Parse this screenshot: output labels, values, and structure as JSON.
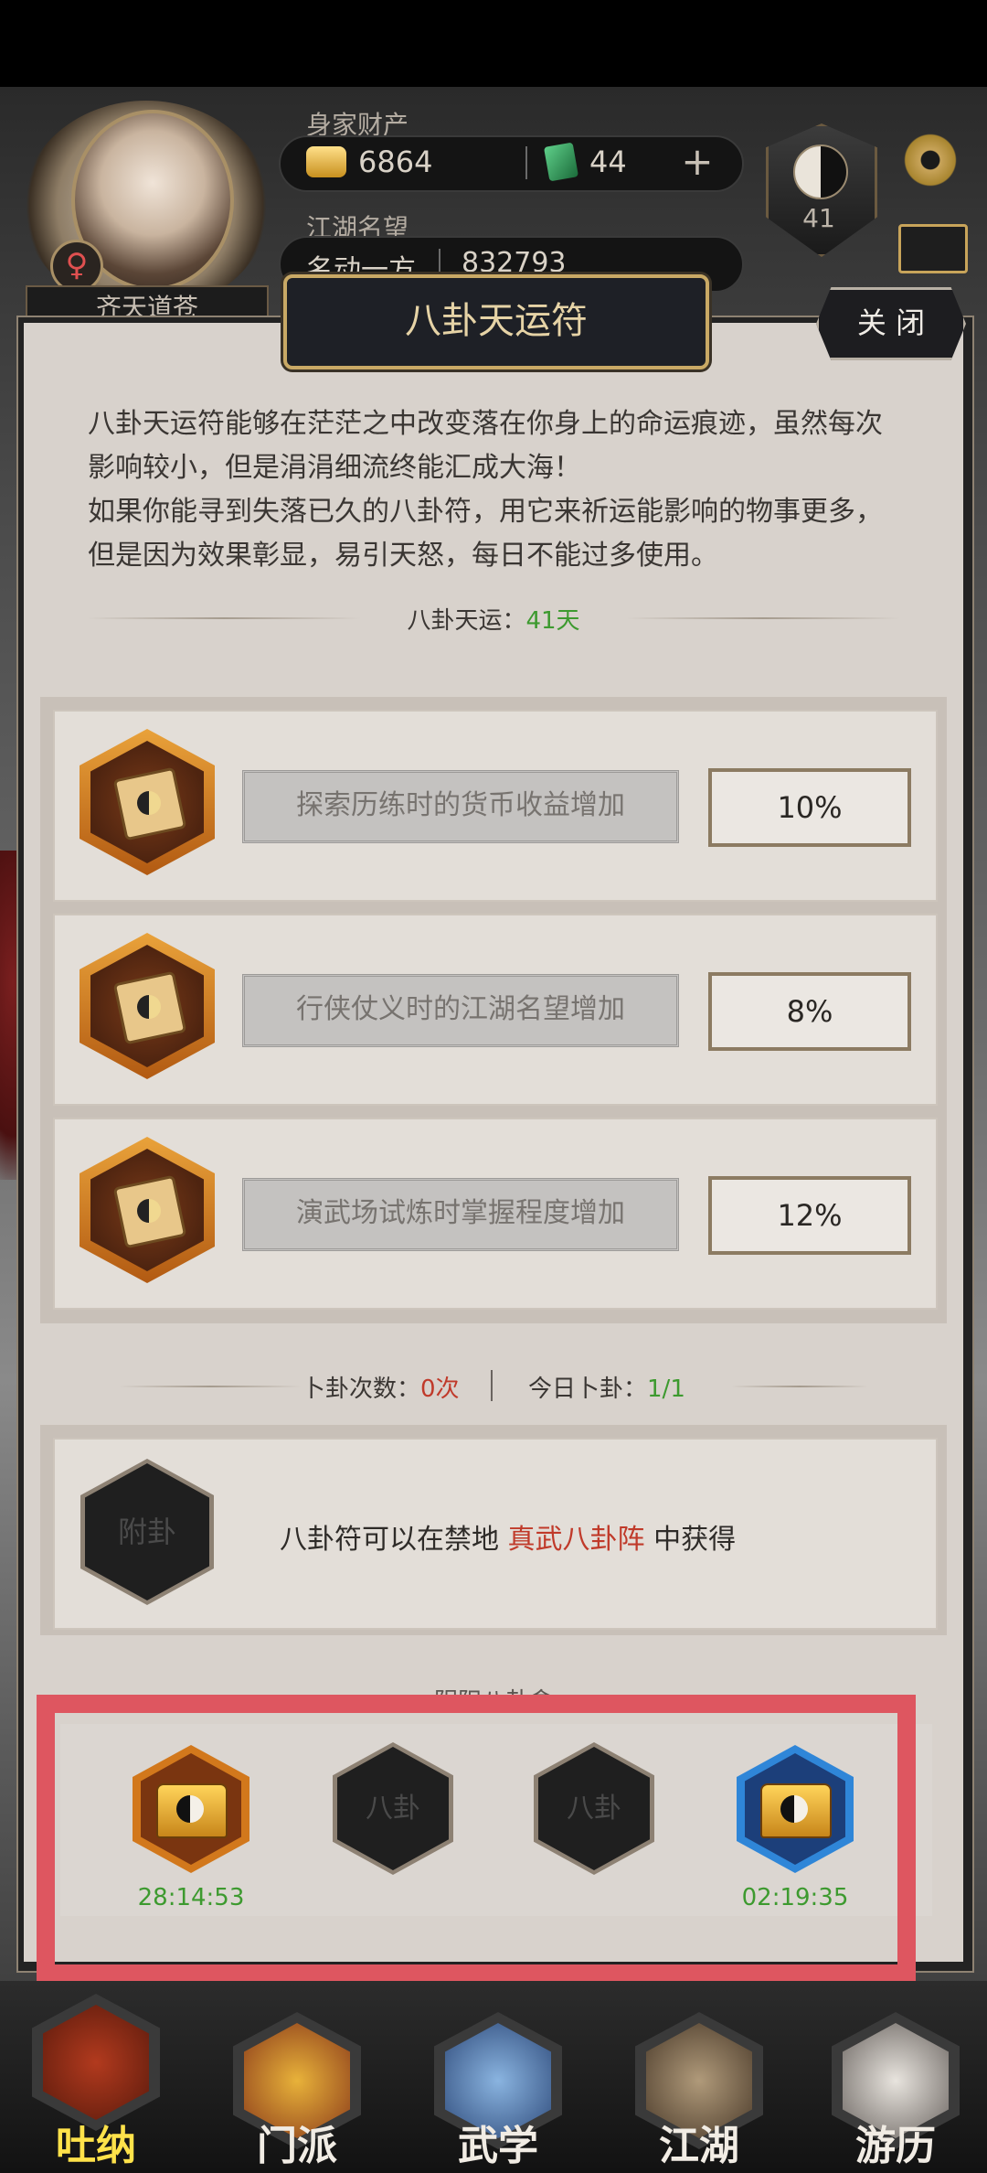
{
  "header": {
    "name": "齐天道苍",
    "gender_symbol": "♀",
    "assets_label": "身家财产",
    "gold": "6864",
    "jade": "44",
    "add_symbol": "+",
    "fame_label": "江湖名望",
    "fame_title": "名动一方",
    "fame_value": "832793",
    "level": "41"
  },
  "dialog": {
    "title": "八卦天运符",
    "close_label": "关 闭",
    "description": "八卦天运符能够在茫茫之中改变落在你身上的命运痕迹，虽然每次影响较小，但是涓涓细流终能汇成大海！\n如果你能寻到失落已久的八卦符，用它来祈运能影响的物事更多，但是因为效果彰显，易引天怒，每日不能过多使用。",
    "fortune_label": "八卦天运：",
    "fortune_value": "41天",
    "bonuses": [
      {
        "label": "探索历练时的货币收益增加",
        "value": "10%"
      },
      {
        "label": "行侠仗义时的江湖名望增加",
        "value": "8%"
      },
      {
        "label": "演武场试炼时掌握程度增加",
        "value": "12%"
      }
    ],
    "divine_count_label": "卜卦次数：",
    "divine_count_value": "0次",
    "divine_today_label": "今日卜卦：",
    "divine_today_value": "1/1",
    "acquire": {
      "slot_label": "附卦",
      "text_before": "八卦符可以在禁地",
      "location": "真武八卦阵",
      "text_after": "中获得"
    },
    "bag_title": "阴阳八卦盒",
    "slots": [
      {
        "type": "chest",
        "timer": "28:14:53",
        "ring_color": "#d2781c"
      },
      {
        "type": "empty",
        "label": "八卦"
      },
      {
        "type": "empty",
        "label": "八卦"
      },
      {
        "type": "chest",
        "timer": "02:19:35",
        "ring_color": "#2f86d8"
      }
    ]
  },
  "nav": [
    {
      "label": "吐纳",
      "active": true
    },
    {
      "label": "门派"
    },
    {
      "label": "武学"
    },
    {
      "label": "江湖"
    },
    {
      "label": "游历"
    }
  ],
  "colors": {
    "highlight": "#de5660",
    "value_green": "#3d9a2f",
    "location_red": "#c03a2a",
    "title_gold": "#e6d3a6"
  }
}
